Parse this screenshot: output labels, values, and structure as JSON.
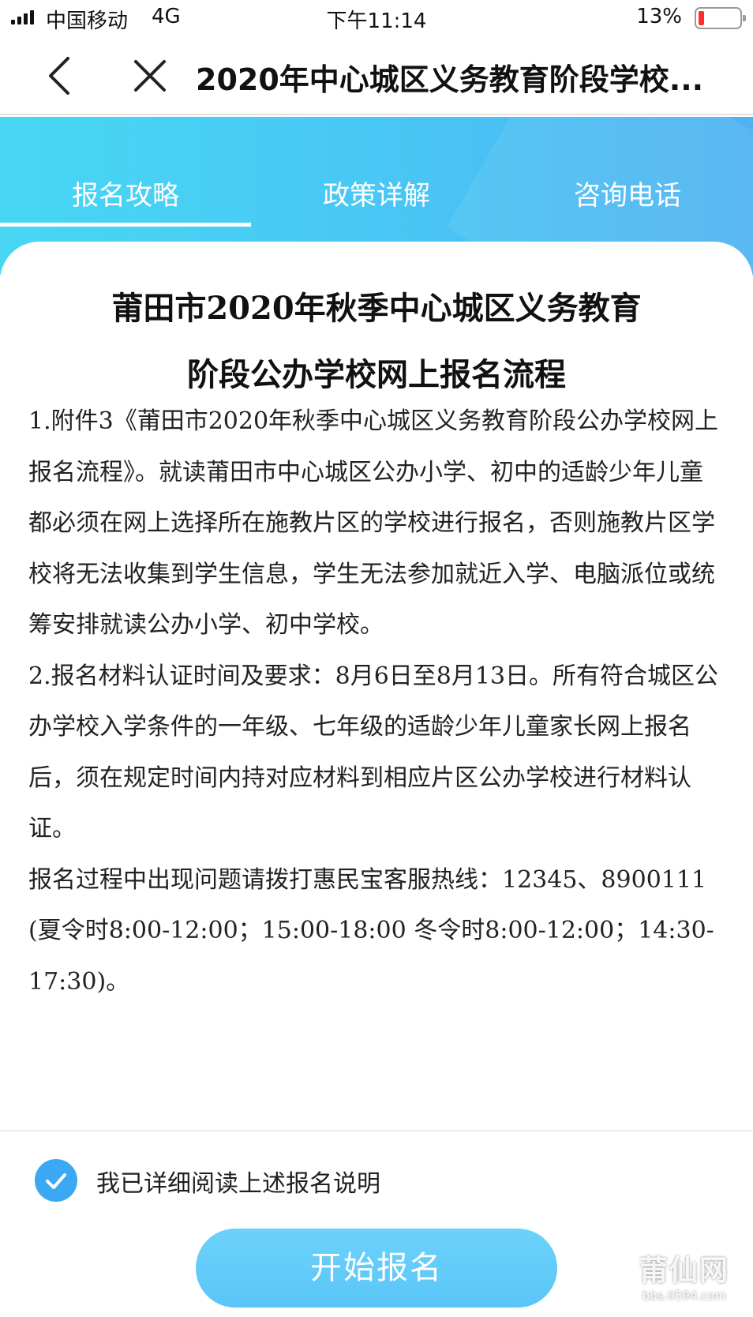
{
  "status_bar": {
    "carrier": "中国移动",
    "network": "4G",
    "time": "下午11:14",
    "battery_percent": "13%",
    "battery_level": 0.13
  },
  "nav": {
    "title": "2020年中心城区义务教育阶段学校...",
    "back_icon": "chevron-left-icon",
    "close_icon": "close-icon"
  },
  "tabs": [
    {
      "label": "报名攻略",
      "active": true
    },
    {
      "label": "政策详解",
      "active": false
    },
    {
      "label": "咨询电话",
      "active": false
    }
  ],
  "document": {
    "title_line1": "莆田市2020年秋季中心城区义务教育",
    "title_line2": "阶段公办学校网上报名流程",
    "paragraphs": [
      "1.附件3《莆田市2020年秋季中心城区义务教育阶段公办学校网上报名流程》。就读莆田市中心城区公办小学、初中的适龄少年儿童都必须在网上选择所在施教片区的学校进行报名，否则施教片区学校将无法收集到学生信息，学生无法参加就近入学、电脑派位或统筹安排就读公办小学、初中学校。",
      "2.报名材料认证时间及要求：8月6日至8月13日。所有符合城区公办学校入学条件的一年级、七年级的适龄少年儿童家长网上报名后，须在规定时间内持对应材料到相应片区公办学校进行材料认证。",
      "报名过程中出现问题请拨打惠民宝客服热线：12345、8900111 (夏令时8:00-12:00；15:00-18:00 冬令时8:00-12:00；14:30-17:30)。"
    ]
  },
  "agreement": {
    "label": "我已详细阅读上述报名说明",
    "checked": true
  },
  "start_button": {
    "label": "开始报名"
  },
  "watermark": {
    "main": "莆仙网",
    "sub": "bbs.0594.com"
  },
  "colors": {
    "header_gradient_start": "#47d7f3",
    "header_gradient_end": "#4fb2f2",
    "check_blue": "#3aa8f2",
    "button_blue": "#5ac5f8",
    "battery_low": "#ff2d2d"
  }
}
